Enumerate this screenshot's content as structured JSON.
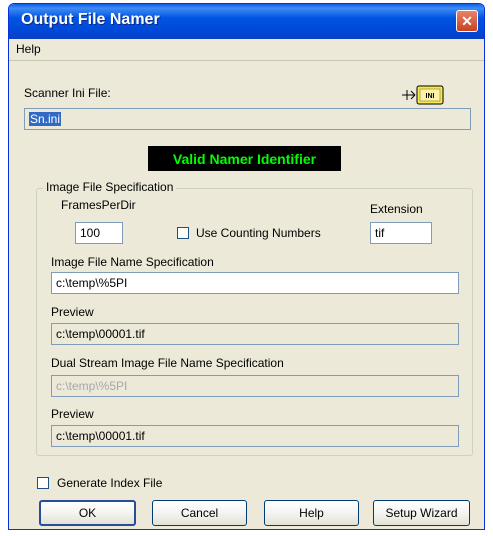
{
  "window": {
    "title": "Output File Namer",
    "close_glyph": "✕"
  },
  "menu": {
    "items": [
      "Help"
    ]
  },
  "scanner": {
    "label": "Scanner Ini File:",
    "value": "Sn.ini",
    "icon": "ini-file-icon",
    "icon_text": "INI"
  },
  "banner": {
    "text": "Valid Namer Identifier",
    "bg": "#000000",
    "fg": "#00ff00"
  },
  "image_spec": {
    "group_title": "Image File Specification",
    "frames_label": "FramesPerDir",
    "frames_value": "100",
    "counting_label": "Use Counting Numbers",
    "counting_checked": false,
    "extension_label": "Extension",
    "extension_value": "tif",
    "name_spec_label": "Image File Name Specification",
    "name_spec_value": "c:\\temp\\%5PI",
    "preview_label": "Preview",
    "preview_value": "c:\\temp\\00001.tif",
    "dual_label": "Dual Stream Image File Name Specification",
    "dual_value": "c:\\temp\\%5PI",
    "dual_preview_label": "Preview",
    "dual_preview_value": "c:\\temp\\00001.tif"
  },
  "generate_index": {
    "label": "Generate Index File",
    "checked": false
  },
  "buttons": {
    "ok": "OK",
    "cancel": "Cancel",
    "help": "Help",
    "setup_wizard": "Setup Wizard"
  }
}
